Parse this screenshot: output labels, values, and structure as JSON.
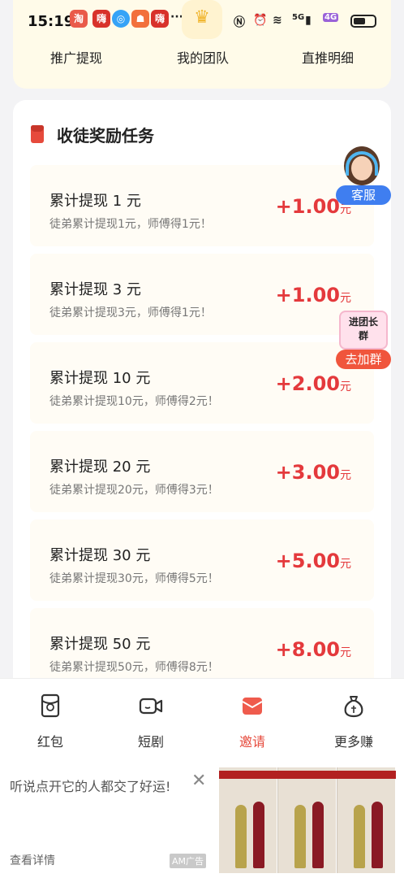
{
  "status_bar": {
    "time": "15:19",
    "network": "5G",
    "network2": "4G",
    "more": "···"
  },
  "top_links": [
    "推广提现",
    "我的团队",
    "直推明细"
  ],
  "panel_title": "收徒奖励任务",
  "tasks": [
    {
      "title": "累计提现 1 元",
      "desc": "徒弟累计提现1元，师傅得1元！",
      "amount": "+1.00",
      "unit": "元"
    },
    {
      "title": "累计提现 3 元",
      "desc": "徒弟累计提现3元，师傅得1元！",
      "amount": "+1.00",
      "unit": "元"
    },
    {
      "title": "累计提现 10 元",
      "desc": "徒弟累计提现10元，师傅得2元！",
      "amount": "+2.00",
      "unit": "元"
    },
    {
      "title": "累计提现 20 元",
      "desc": "徒弟累计提现20元，师傅得3元！",
      "amount": "+3.00",
      "unit": "元"
    },
    {
      "title": "累计提现 30 元",
      "desc": "徒弟累计提现30元，师傅得5元！",
      "amount": "+5.00",
      "unit": "元"
    },
    {
      "title": "累计提现 50 元",
      "desc": "徒弟累计提现50元，师傅得8元！",
      "amount": "+8.00",
      "unit": "元"
    }
  ],
  "float_service": {
    "label": "客服"
  },
  "float_group": {
    "title": "进团长群",
    "label": "去加群"
  },
  "tabbar": [
    {
      "label": "红包",
      "icon": "red-packet-icon"
    },
    {
      "label": "短剧",
      "icon": "video-camera-icon"
    },
    {
      "label": "邀请",
      "icon": "invite-envelope-icon"
    },
    {
      "label": "更多赚",
      "icon": "money-bag-icon"
    }
  ],
  "ad": {
    "text": "听说点开它的人都交了好运!",
    "more": "查看详情",
    "tag": "AM广告",
    "close": "✕"
  },
  "colors": {
    "accent": "#e4393c",
    "service": "#3f7ef0",
    "group": "#f0553c"
  }
}
